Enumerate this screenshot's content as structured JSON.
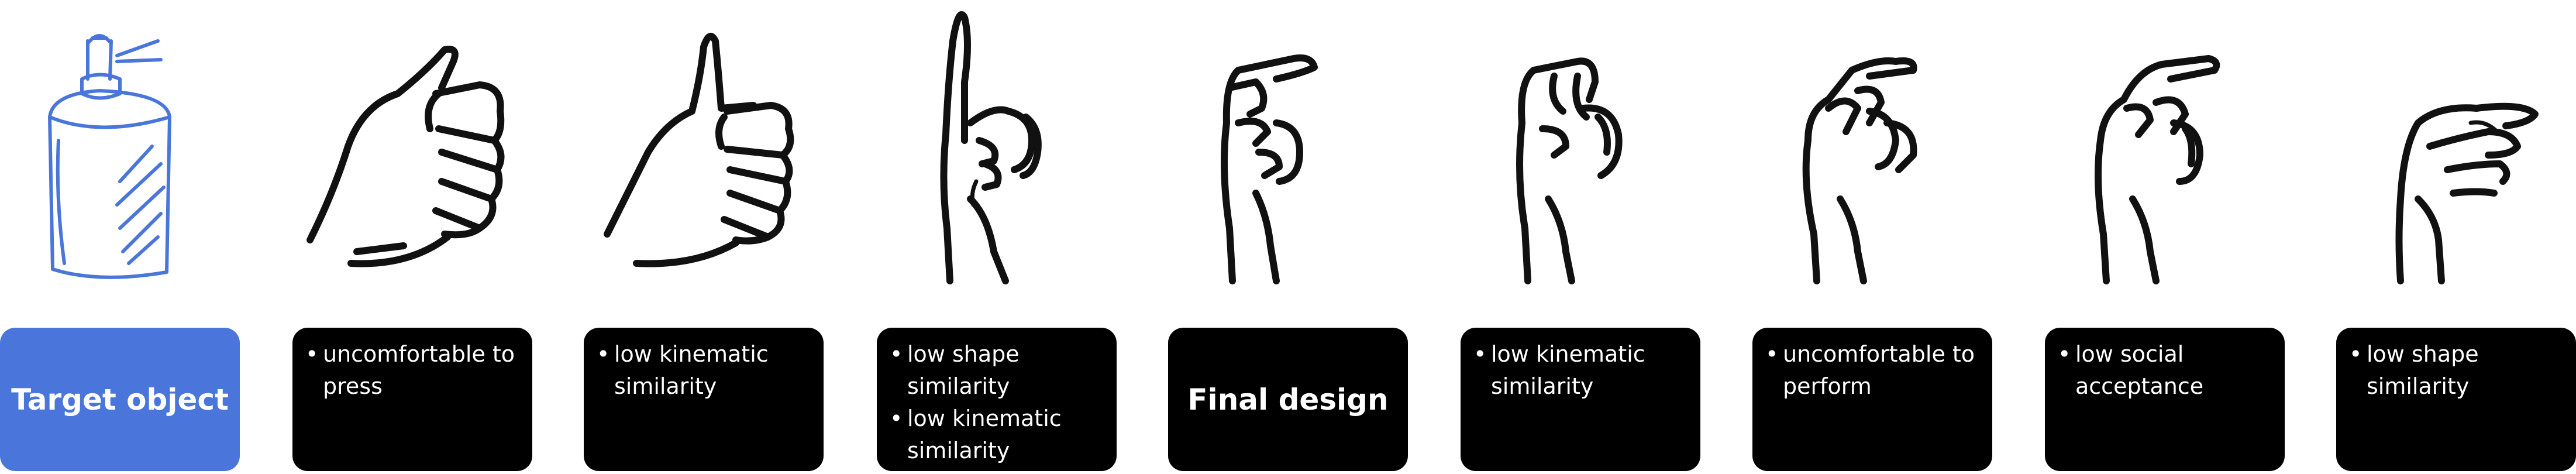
{
  "colors": {
    "accent": "#4a76db",
    "card": "#000000",
    "text": "#ffffff"
  },
  "columns": [
    {
      "icon": "spray-can-icon",
      "title": "Target object",
      "bullets": []
    },
    {
      "icon": "thumbs-up-hand-icon",
      "title": "",
      "bullets": [
        "uncomfortable to\npress"
      ]
    },
    {
      "icon": "thumbs-up-hand-icon",
      "title": "",
      "bullets": [
        "low kinematic\nsimilarity"
      ]
    },
    {
      "icon": "pointing-finger-hand-icon",
      "title": "",
      "bullets": [
        "low shape\nsimilarity",
        "low kinematic\nsimilarity"
      ]
    },
    {
      "icon": "hook-index-hand-icon",
      "title": "Final design",
      "bullets": []
    },
    {
      "icon": "hook-index-hand-icon",
      "title": "",
      "bullets": [
        "low kinematic\nsimilarity"
      ]
    },
    {
      "icon": "hook-index-hand-icon",
      "title": "",
      "bullets": [
        "uncomfortable to\nperform"
      ]
    },
    {
      "icon": "hook-index-hand-icon",
      "title": "",
      "bullets": [
        "low social\nacceptance"
      ]
    },
    {
      "icon": "pinch-hand-icon",
      "title": "",
      "bullets": [
        "low shape\nsimilarity"
      ]
    }
  ]
}
